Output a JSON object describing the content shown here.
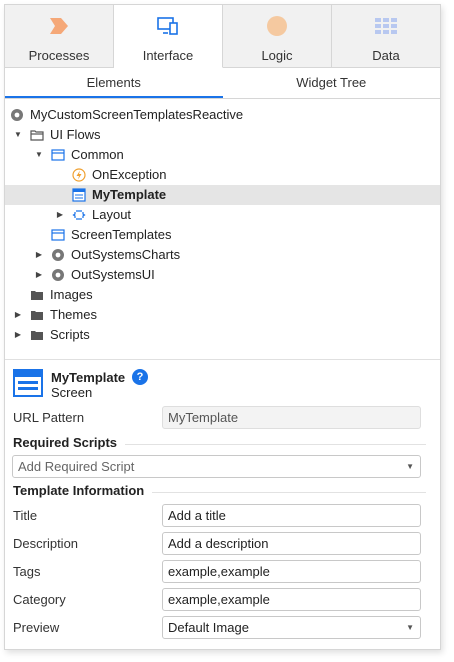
{
  "tabs": [
    {
      "label": "Processes",
      "icon": "processes-chevron-icon",
      "color": "#f5a878"
    },
    {
      "label": "Interface",
      "icon": "interface-monitor-icon",
      "color": "#1a73e8"
    },
    {
      "label": "Logic",
      "icon": "logic-circle-icon",
      "color": "#f5c9a0"
    },
    {
      "label": "Data",
      "icon": "data-grid-icon",
      "color": "#b8c8f0"
    }
  ],
  "subtabs": [
    "Elements",
    "Widget Tree"
  ],
  "tree": {
    "root": "MyCustomScreenTemplatesReactive",
    "ui_flows": "UI Flows",
    "common": "Common",
    "on_exception": "OnException",
    "my_template": "MyTemplate",
    "layout": "Layout",
    "screen_templates": "ScreenTemplates",
    "outsystems_charts": "OutSystemsCharts",
    "outsystems_ui": "OutSystemsUI",
    "images": "Images",
    "themes": "Themes",
    "scripts": "Scripts"
  },
  "properties": {
    "name": "MyTemplate",
    "kind": "Screen",
    "help": "?",
    "url_pattern_label": "URL Pattern",
    "url_pattern_value": "MyTemplate",
    "required_scripts_header": "Required Scripts",
    "add_required_script": "Add Required Script",
    "template_info_header": "Template Information",
    "title_label": "Title",
    "title_value": "Add a title",
    "description_label": "Description",
    "description_value": "Add a description",
    "tags_label": "Tags",
    "tags_value": "example,example",
    "category_label": "Category",
    "category_value": "example,example",
    "preview_label": "Preview",
    "preview_value": "Default Image"
  }
}
